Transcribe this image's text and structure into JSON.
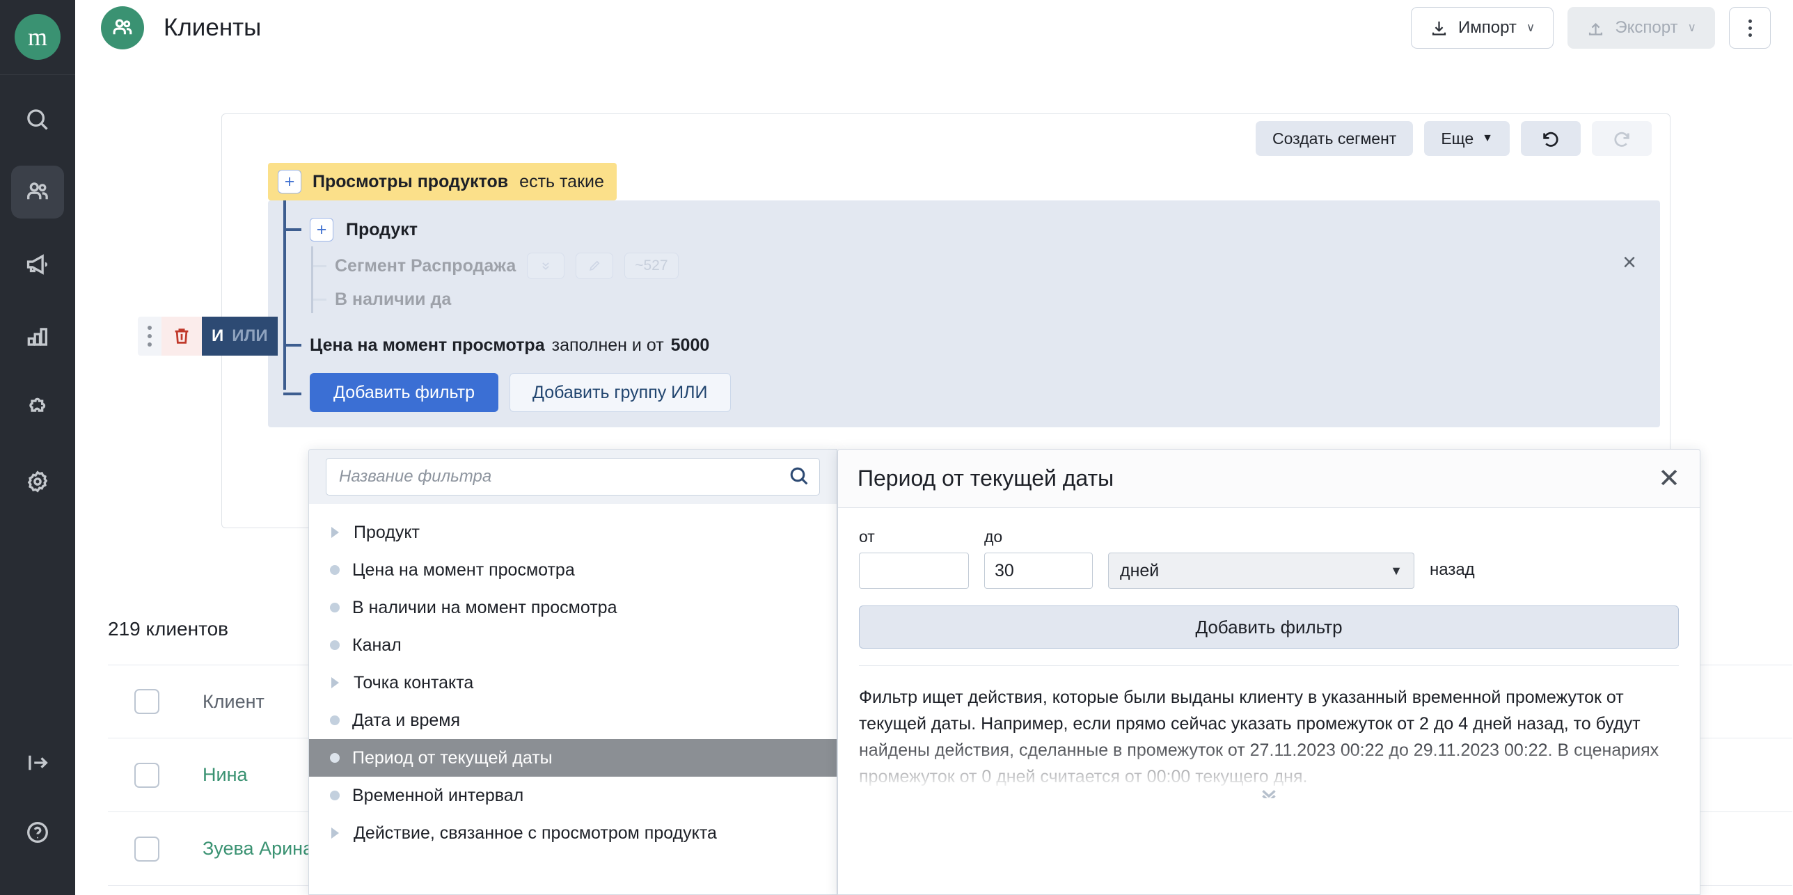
{
  "sidebar": {
    "logo_text": "m",
    "items": [
      {
        "name": "search-icon",
        "label": "Поиск"
      },
      {
        "name": "clients-icon",
        "label": "Клиенты"
      },
      {
        "name": "campaigns-megaphone-icon",
        "label": "Кампании"
      },
      {
        "name": "analytics-bar-chart-icon",
        "label": "Аналитика"
      },
      {
        "name": "integrations-puzzle-icon",
        "label": "Интеграции"
      },
      {
        "name": "settings-gear-icon",
        "label": "Настройки"
      }
    ],
    "bottom_items": [
      {
        "name": "expand-panel-icon",
        "label": "Развернуть"
      },
      {
        "name": "help-icon",
        "label": "Помощь"
      }
    ]
  },
  "header": {
    "title": "Клиенты",
    "import_label": "Импорт",
    "export_label": "Экспорт",
    "caret": "∨",
    "more_menu": "more-vertical"
  },
  "toolbar": {
    "create_segment": "Создать сегмент",
    "more": "Еще",
    "more_caret": "▼",
    "undo": "undo",
    "redo": "redo"
  },
  "filter_tree": {
    "root": {
      "label_bold": "Просмотры продуктов",
      "label_normal": "есть такие"
    },
    "product": {
      "label": "Продукт"
    },
    "sub_rows": [
      {
        "label": "Сегмент Распродажа",
        "chips": [
          "chevrons",
          "pencil",
          "~527"
        ]
      },
      {
        "label": "В наличии да",
        "chips": []
      }
    ],
    "price_row": {
      "bold": "Цена на момент просмотра",
      "normal": "заполнен и от",
      "value": "5000"
    },
    "add_filter": "Добавить фильтр",
    "add_or_group": "Добавить группу ИЛИ",
    "and_label": "И",
    "or_label": "ИЛИ",
    "close": "×"
  },
  "picker": {
    "placeholder": "Название фильтра",
    "value": "",
    "items": [
      {
        "label": "Продукт",
        "marker": "triangle",
        "selected": false
      },
      {
        "label": "Цена на момент просмотра",
        "marker": "dot",
        "selected": false
      },
      {
        "label": "В наличии на момент просмотра",
        "marker": "dot",
        "selected": false
      },
      {
        "label": "Канал",
        "marker": "dot",
        "selected": false
      },
      {
        "label": "Точка контакта",
        "marker": "triangle",
        "selected": false
      },
      {
        "label": "Дата и время",
        "marker": "dot",
        "selected": false
      },
      {
        "label": "Период от текущей даты",
        "marker": "dot",
        "selected": true
      },
      {
        "label": "Временной интервал",
        "marker": "dot",
        "selected": false
      },
      {
        "label": "Действие, связанное с просмотром продукта",
        "marker": "triangle",
        "selected": false
      }
    ]
  },
  "detail": {
    "title": "Период от текущей даты",
    "close": "✕",
    "from_label": "от",
    "from_value": "",
    "to_label": "до",
    "to_value": "30",
    "unit_value": "дней",
    "unit_caret": "▼",
    "suffix": "назад",
    "add_filter": "Добавить фильтр",
    "description": "Фильтр ищет действия, которые были выданы клиенту в указанный временной промежуток от текущей даты. Например, если прямо сейчас указать промежуток от 2 до 4 дней назад, то будут найдены действия, сделанные в промежуток от 27.11.2023 00:22 до 29.11.2023 00:22. В сценариях промежуток от 0 дней считается от 00:00 текущего дня."
  },
  "clients": {
    "count_label": "219 клиентов",
    "column_header": "Клиент",
    "rows": [
      {
        "name": "Нина"
      },
      {
        "name": "Зуева Арина"
      }
    ]
  },
  "colors": {
    "brand_green": "#3a9272",
    "accent_blue": "#3b6fd4",
    "highlight_yellow": "#fbe08a",
    "group_bg": "#e3e8f1",
    "rail_bg": "#282c33"
  }
}
